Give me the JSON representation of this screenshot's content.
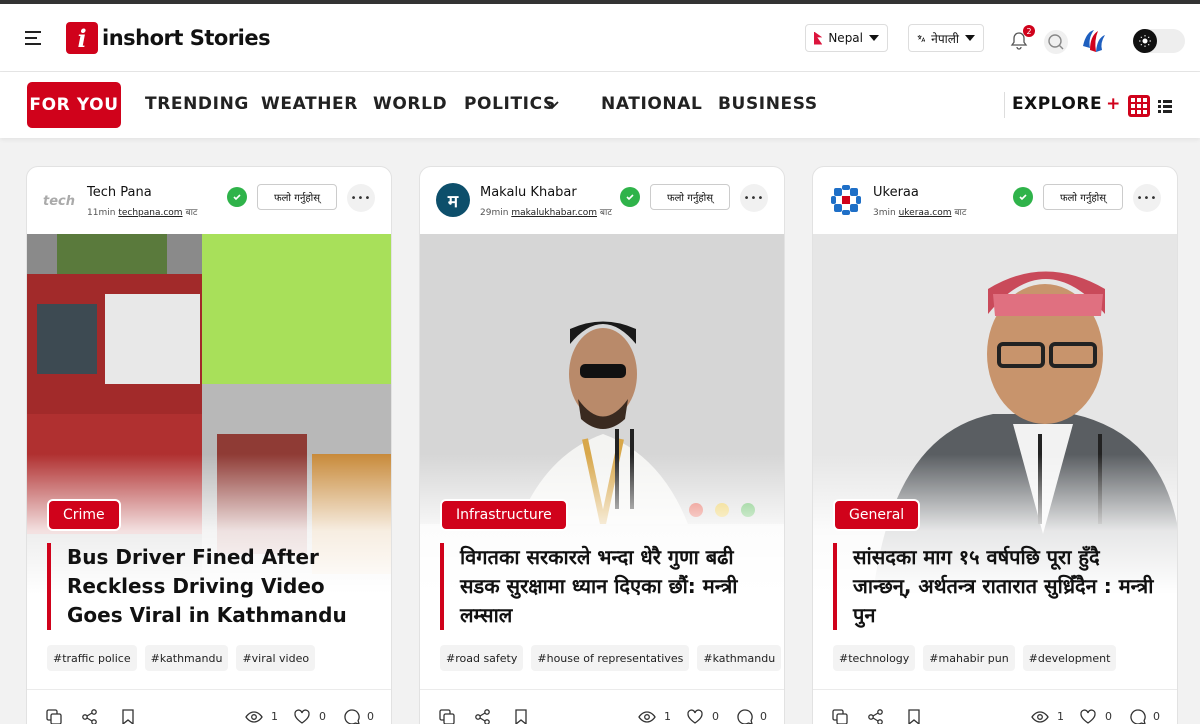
{
  "header": {
    "logo_text": "inshort Stories",
    "logo_mark": "i",
    "country": "Nepal",
    "language": "नेपाली",
    "notification_count": "2",
    "icons": [
      "menu-icon",
      "bell-icon",
      "search-icon",
      "theme-icon"
    ]
  },
  "nav": {
    "items": [
      "FOR YOU",
      "TRENDING",
      "WEATHER",
      "WORLD",
      "POLITICS",
      "NATIONAL",
      "BUSINESS"
    ],
    "explore": "EXPLORE",
    "explore_plus": "+"
  },
  "colors": {
    "accent": "#d0021b",
    "verified": "#2fb34a"
  },
  "cards": [
    {
      "source": "Tech Pana",
      "time": "11min",
      "domain": "techpana.com",
      "suffix": "बाट",
      "follow": "फलो गर्नुहोस्",
      "category": "Crime",
      "title": "Bus Driver Fined After Reckless Driving Video Goes Viral in Kathmandu",
      "tags": [
        "#traffic police",
        "#kathmandu",
        "#viral video"
      ],
      "views": "1",
      "likes": "0",
      "comments": "0"
    },
    {
      "source": "Makalu Khabar",
      "time": "29min",
      "domain": "makalukhabar.com",
      "suffix": "बाट",
      "follow": "फलो गर्नुहोस्",
      "category": "Infrastructure",
      "title": "विगतका सरकारले भन्दा धेरै गुणा बढी सडक सुरक्षामा ध्यान दिएका छौं: मन्त्री लम्साल",
      "tags": [
        "#road safety",
        "#house of representatives",
        "#kathmandu"
      ],
      "views": "1",
      "likes": "0",
      "comments": "0"
    },
    {
      "source": "Ukeraa",
      "time": "3min",
      "domain": "ukeraa.com",
      "suffix": "बाट",
      "follow": "फलो गर्नुहोस्",
      "category": "General",
      "title": "सांसदका माग १५ वर्षपछि पूरा हुँदै जान्छन्, अर्थतन्त्र रातारात सुध्रिँदैन : मन्त्री पुन",
      "tags": [
        "#technology",
        "#mahabir pun",
        "#development"
      ],
      "views": "1",
      "likes": "0",
      "comments": "0"
    }
  ]
}
